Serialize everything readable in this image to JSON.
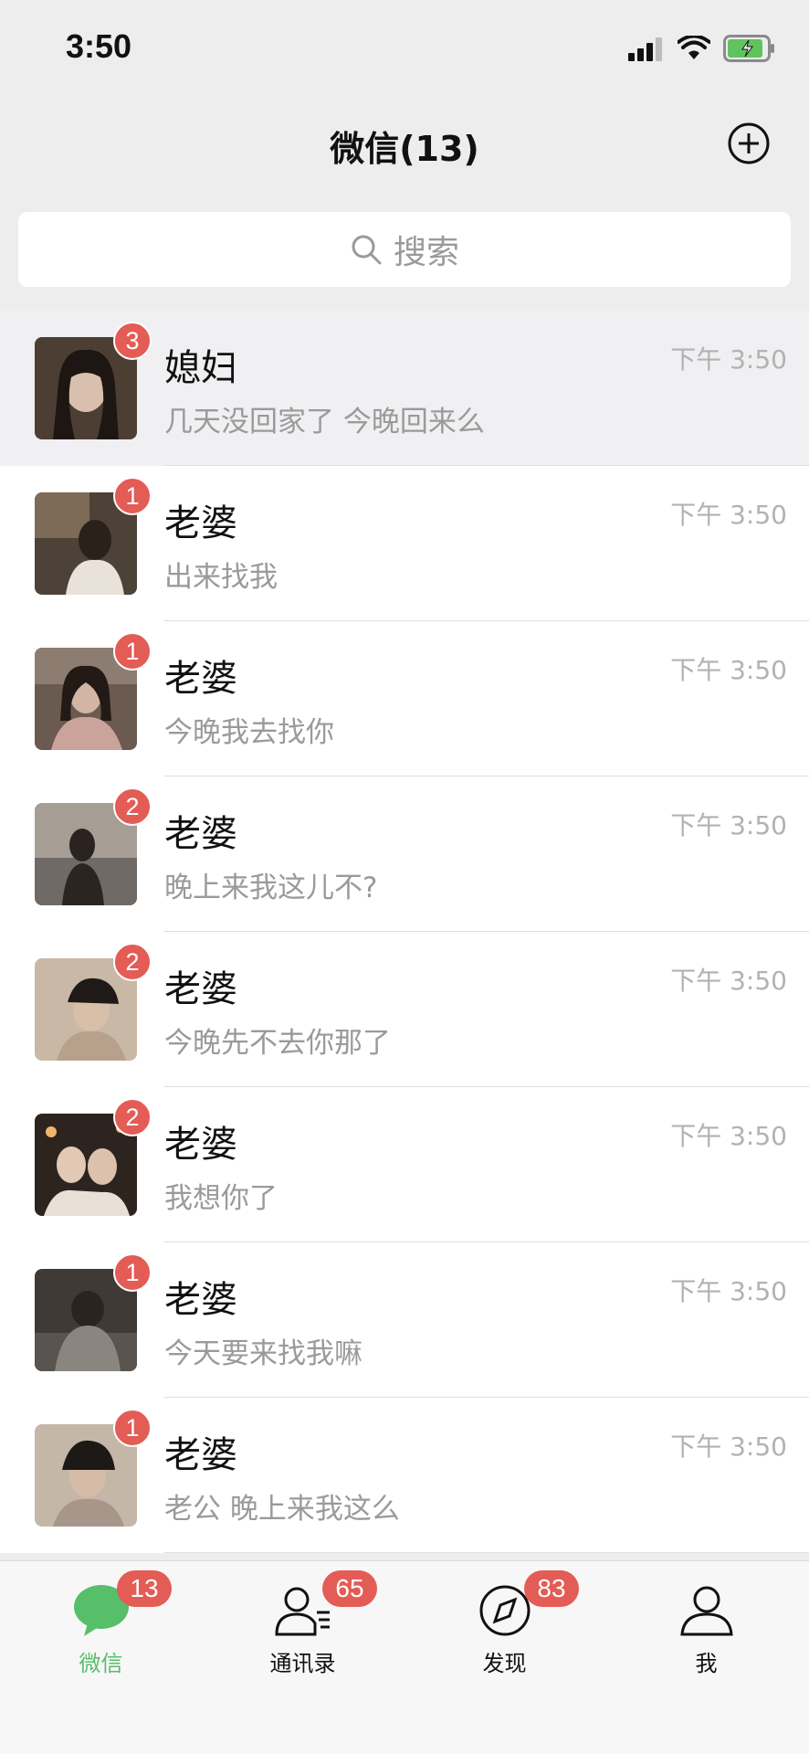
{
  "status": {
    "time": "3:50"
  },
  "nav": {
    "title": "微信(13)"
  },
  "search": {
    "placeholder": "搜索"
  },
  "chats": [
    {
      "name": "媳妇",
      "preview": "几天没回家了 今晚回来么",
      "time": "下午 3:50",
      "badge": "3",
      "pinned": true
    },
    {
      "name": "老婆",
      "preview": "出来找我",
      "time": "下午 3:50",
      "badge": "1"
    },
    {
      "name": "老婆",
      "preview": "今晚我去找你",
      "time": "下午 3:50",
      "badge": "1"
    },
    {
      "name": "老婆",
      "preview": "晚上来我这儿不?",
      "time": "下午 3:50",
      "badge": "2"
    },
    {
      "name": "老婆",
      "preview": "今晚先不去你那了",
      "time": "下午 3:50",
      "badge": "2"
    },
    {
      "name": "老婆",
      "preview": "我想你了",
      "time": "下午 3:50",
      "badge": "2"
    },
    {
      "name": "老婆",
      "preview": "今天要来找我嘛",
      "time": "下午 3:50",
      "badge": "1"
    },
    {
      "name": "老婆",
      "preview": "老公 晚上来我这么",
      "time": "下午 3:50",
      "badge": "1"
    }
  ],
  "tabs": [
    {
      "label": "微信",
      "badge": "13",
      "icon": "chat-bubble-icon",
      "active": true
    },
    {
      "label": "通讯录",
      "badge": "65",
      "icon": "contacts-icon"
    },
    {
      "label": "发现",
      "badge": "83",
      "icon": "compass-icon"
    },
    {
      "label": "我",
      "icon": "person-icon"
    }
  ],
  "colors": {
    "accent": "#57be6a",
    "badge": "#e35c55",
    "background": "#ededed"
  }
}
